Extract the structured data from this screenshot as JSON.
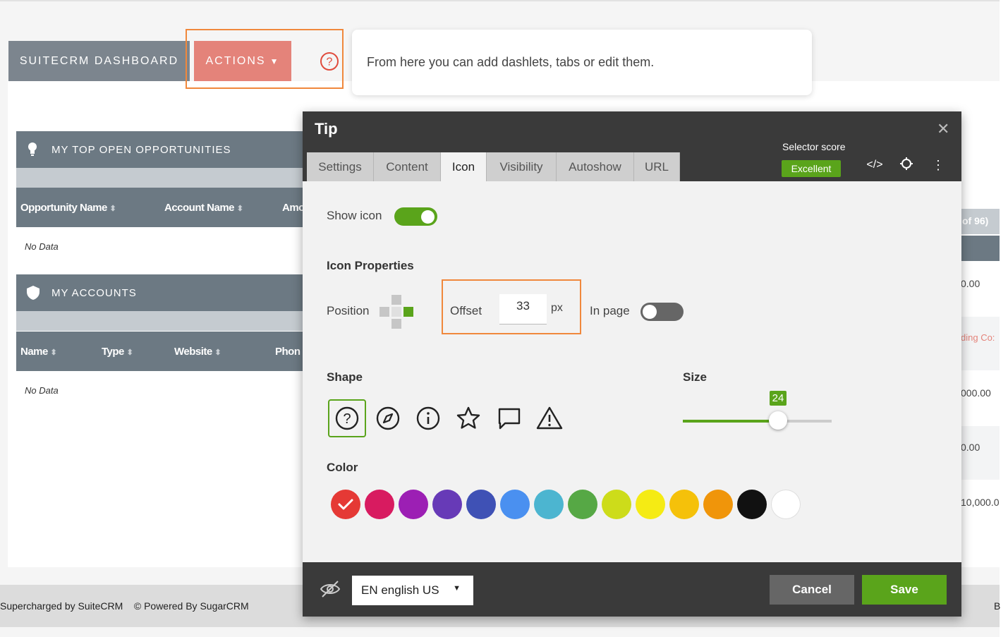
{
  "dashboard": {
    "tab_label": "SUITECRM DASHBOARD",
    "actions_label": "ACTIONS",
    "callout_text": "From here you can add dashlets, tabs or edit them."
  },
  "dashlets": [
    {
      "title": "MY TOP OPEN OPPORTUNITIES",
      "icon": "lightbulb-icon",
      "columns": [
        "Opportunity Name",
        "Account Name",
        "Amo"
      ],
      "empty_text": "No Data"
    },
    {
      "title": "MY ACCOUNTS",
      "icon": "shield-icon",
      "columns": [
        "Name",
        "Type",
        "Website",
        "Phon"
      ],
      "empty_text": "No Data"
    }
  ],
  "right_column": {
    "pagination": "of 96)",
    "cells": [
      "0.00",
      "ding Co:",
      "000.00",
      "0.00",
      "10,000.0"
    ]
  },
  "footer": {
    "left_text": "Supercharged by SuiteCRM    © Powered By SugarCRM",
    "right_text": "B"
  },
  "modal": {
    "title": "Tip",
    "tabs": [
      "Settings",
      "Content",
      "Icon",
      "Visibility",
      "Autoshow",
      "URL"
    ],
    "active_tab": "Icon",
    "selector_score_label": "Selector score",
    "selector_score_value": "Excellent",
    "show_icon_label": "Show icon",
    "show_icon_enabled": true,
    "icon_properties_heading": "Icon Properties",
    "position_label": "Position",
    "offset_label": "Offset",
    "offset_value": "33",
    "offset_unit": "px",
    "in_page_label": "In page",
    "in_page_enabled": false,
    "shape_heading": "Shape",
    "shapes": [
      "question-circle-icon",
      "compass-icon",
      "info-circle-icon",
      "star-icon",
      "speech-bubble-icon",
      "warning-triangle-icon"
    ],
    "selected_shape": "question-circle-icon",
    "size_heading": "Size",
    "size_value": "24",
    "size_fraction": 0.64,
    "color_heading": "Color",
    "colors": [
      "#e53935",
      "#d81b60",
      "#9c1fb4",
      "#673ab7",
      "#3f51b5",
      "#4a90f0",
      "#4cb5d0",
      "#56a845",
      "#cddc1a",
      "#f5eb14",
      "#f5c10a",
      "#f0950a",
      "#111111",
      "#ffffff"
    ],
    "selected_color": "#e53935",
    "language": "EN english US",
    "cancel_label": "Cancel",
    "save_label": "Save"
  }
}
